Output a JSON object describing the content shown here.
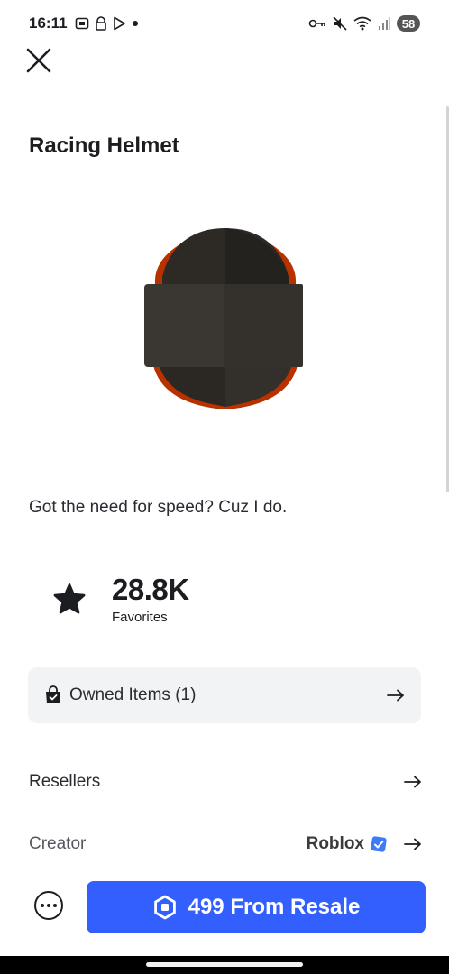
{
  "status_bar": {
    "time": "16:11",
    "battery": "58",
    "left_icons": [
      "screenshot-icon",
      "lock-icon",
      "play-store-icon",
      "notification-dot-icon"
    ],
    "right_icons": [
      "vpn-key-icon",
      "muted-icon",
      "wifi-icon",
      "signal-icon"
    ]
  },
  "item": {
    "title": "Racing Helmet",
    "description": "Got the need for speed? Cuz I do.",
    "favorites_count": "28.8K",
    "favorites_label": "Favorites"
  },
  "owned": {
    "label": "Owned Items (1)"
  },
  "rows": {
    "resellers_label": "Resellers",
    "creator_label": "Creator",
    "creator_name": "Roblox"
  },
  "purchase": {
    "button_label": "499 From Resale"
  },
  "colors": {
    "accent": "#335fff",
    "verified": "#3d7bf7",
    "owned_bg": "#f2f3f4"
  }
}
